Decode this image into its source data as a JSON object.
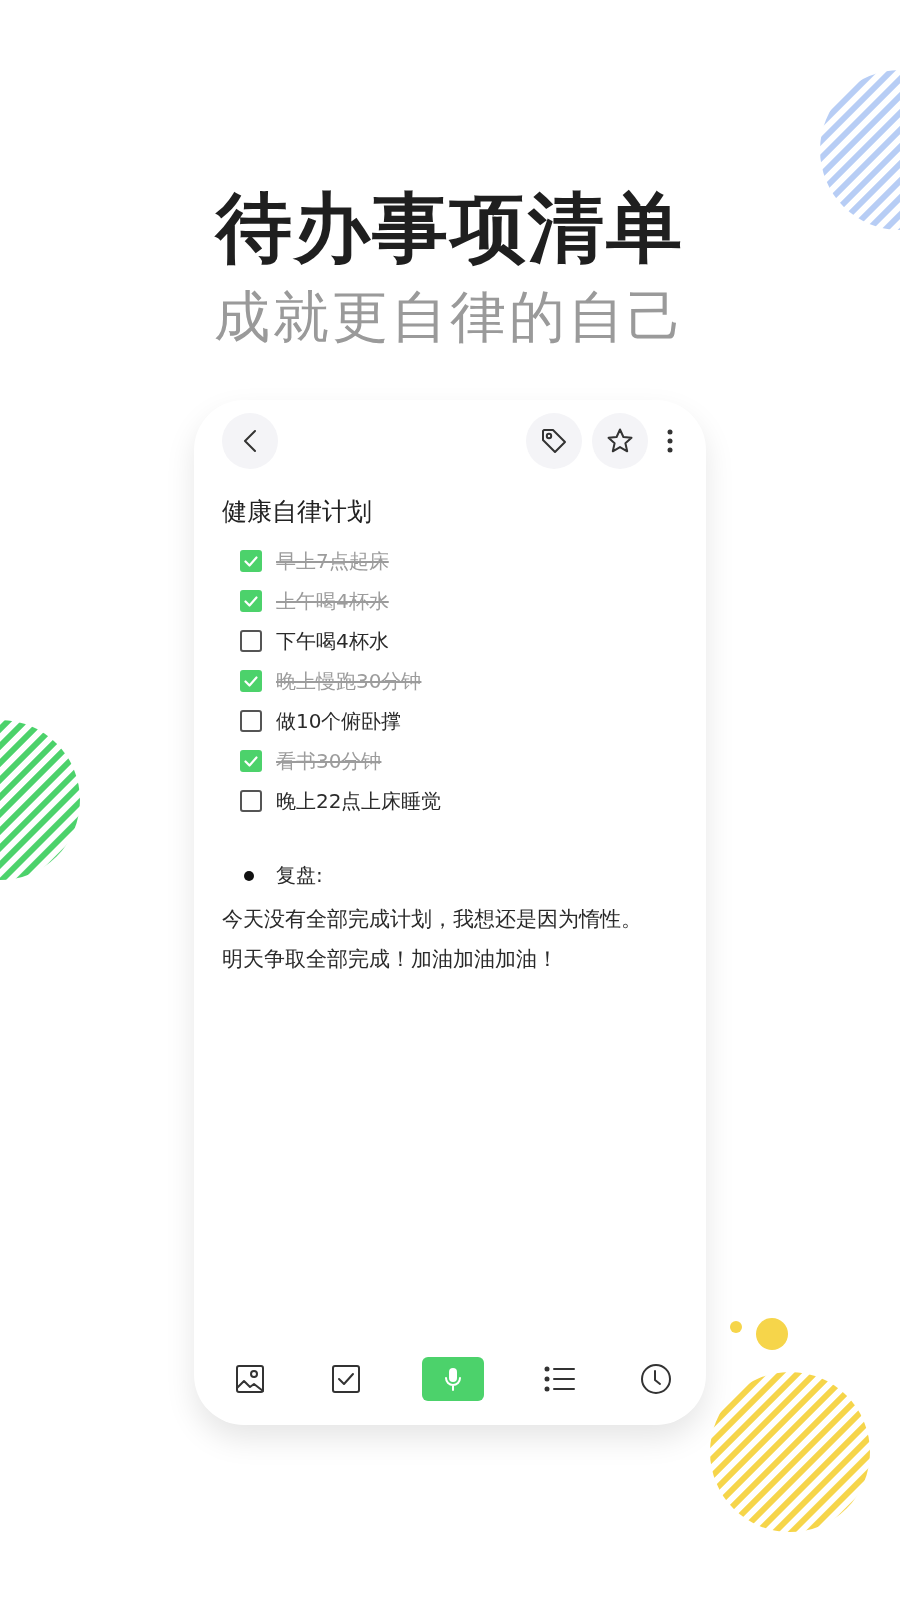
{
  "headline": "待办事项清单",
  "subtitle": "成就更自律的自己",
  "note": {
    "title": "健康自律计划",
    "items": [
      {
        "text": "早上7点起床",
        "checked": true
      },
      {
        "text": "上午喝4杯水",
        "checked": true
      },
      {
        "text": "下午喝4杯水",
        "checked": false
      },
      {
        "text": "晚上慢跑30分钟",
        "checked": true
      },
      {
        "text": "做10个俯卧撑",
        "checked": false
      },
      {
        "text": "看书30分钟",
        "checked": true
      },
      {
        "text": "晚上22点上床睡觉",
        "checked": false
      }
    ],
    "bullet": "复盘:",
    "paragraph": "今天没有全部完成计划，我想还是因为惰性。明天争取全部完成！加油加油加油！"
  }
}
